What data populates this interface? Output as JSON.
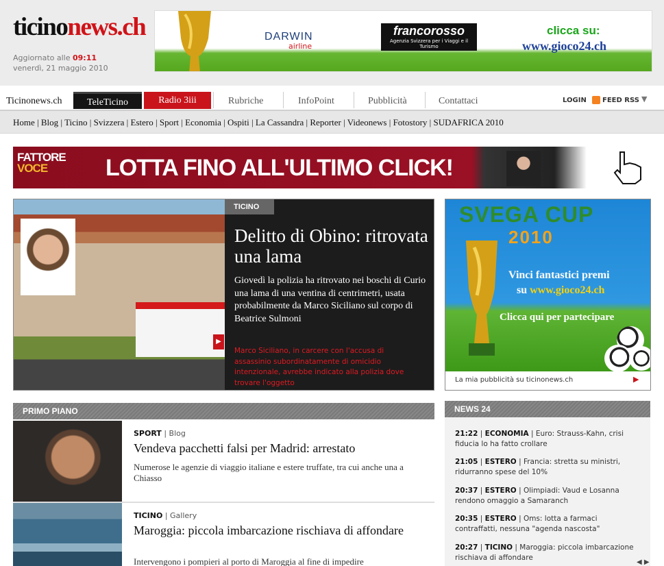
{
  "header": {
    "logo_part1": "ticino",
    "logo_part2": "news.ch",
    "updated_label": "Aggiornato alle ",
    "updated_time": "09:11",
    "date": "venerdì, 21 maggio 2010",
    "banner": {
      "darwin": "DARWIN",
      "darwin_sub": "airline",
      "francorosso": "francorosso",
      "francorosso_sub": "Agenzia Svizzera per i Viaggi e il Turismo",
      "cta_line1": "clicca su:",
      "cta_line2": "www.gioco24.ch"
    }
  },
  "nav": {
    "home": "Ticinonews.ch",
    "teleticino": "TeleTicino",
    "radio": "Radio 3iii",
    "items": [
      "Rubriche",
      "InfoPoint",
      "Pubblicità",
      "Contattaci"
    ],
    "login": "LOGIN",
    "rss": "FEED RSS"
  },
  "subnav": [
    "Home",
    "Blog",
    "Ticino",
    "Svizzera",
    "Estero",
    "Sport",
    "Economia",
    "Ospiti",
    "La Cassandra",
    "Reporter",
    "Videonews",
    "Fotostory",
    "SUDAFRICA 2010"
  ],
  "promo": {
    "brand_line1": "FATTORE",
    "brand_line2": "VOCE",
    "text": "LOTTA FINO ALL'ULTIMO CLICK!"
  },
  "hero": {
    "tag": "TICINO",
    "title": "Delitto di Obino: ritrovata una lama",
    "text": "Giovedì la polizia ha ritrovato nei boschi di Curio una lama di una ventina di centrimetri, usata probabilmente da Marco Siciliano sul corpo di Beatrice Sulmoni",
    "note": "Marco Siciliano, in carcere con l'accusa di assassinio subordinatamente di omicidio intenzionale, avrebbe indicato alla polizia dove trovare l'oggetto"
  },
  "ad": {
    "logo": "SVEGA CUP",
    "logo2": "2010",
    "line1": "Vinci fantastici premi",
    "line2_a": "su ",
    "line2_b": "www.gioco24.ch",
    "line3": "Clicca qui per partecipare",
    "caption": "La mia pubblicità su ticinonews.ch"
  },
  "primo_piano": {
    "heading": "PRIMO PIANO",
    "stories": [
      {
        "section": "SPORT",
        "type": "Blog",
        "title": "Vendeva pacchetti falsi per Madrid: arrestato",
        "lead": "Numerose le agenzie di viaggio italiane e estere truffate, tra cui anche una a Chiasso"
      },
      {
        "section": "TICINO",
        "type": "Gallery",
        "title": "Maroggia: piccola imbarcazione rischiava di affondare",
        "lead": "Intervengono i pompieri al porto di Maroggia al fine di impedire"
      }
    ]
  },
  "news24": {
    "heading": "NEWS 24",
    "items": [
      {
        "time": "21:22",
        "section": "ECONOMIA",
        "text": "Euro: Strauss-Kahn, crisi fiducia lo ha fatto crollare"
      },
      {
        "time": "21:05",
        "section": "ESTERO",
        "text": "Francia: stretta su ministri, ridurranno spese del 10%"
      },
      {
        "time": "20:37",
        "section": "ESTERO",
        "text": "Olimpiadi: Vaud e Losanna rendono omaggio a Samaranch"
      },
      {
        "time": "20:35",
        "section": "ESTERO",
        "text": "Oms: lotta a farmaci contraffatti, nessuna \"agenda nascosta\""
      },
      {
        "time": "20:27",
        "section": "TICINO",
        "text": "Maroggia: piccola imbarcazione rischiava di affondare"
      }
    ]
  },
  "colors": {
    "accent": "#d01318",
    "dark": "#151515",
    "gray_header": "#7a7a7a"
  }
}
